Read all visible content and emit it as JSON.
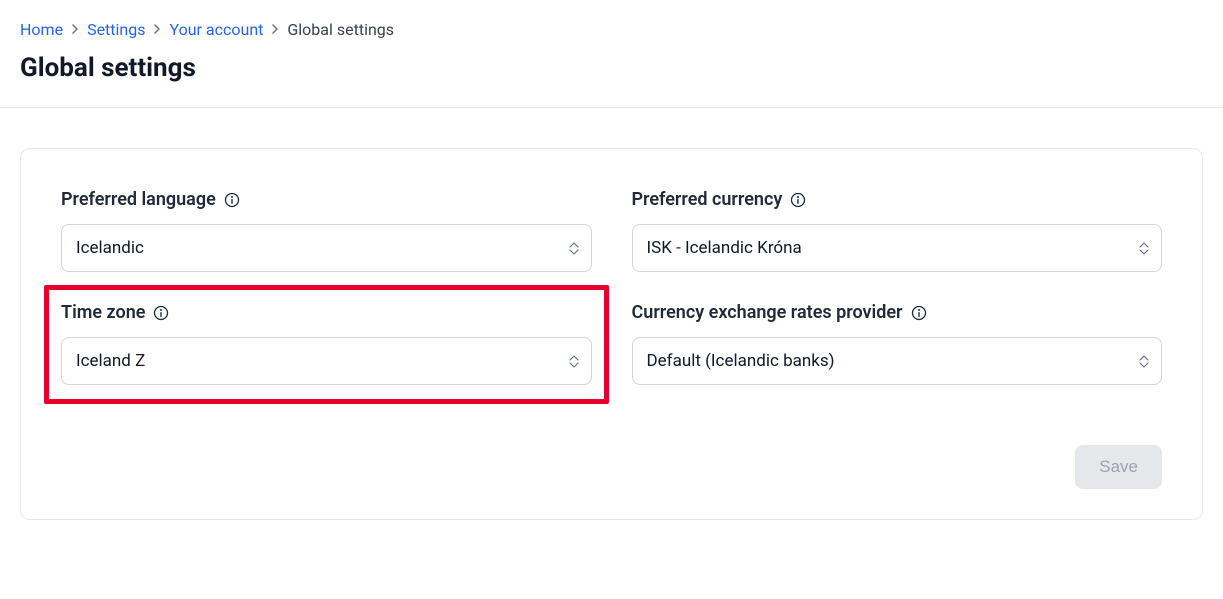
{
  "breadcrumb": {
    "home": "Home",
    "settings": "Settings",
    "your_account": "Your account",
    "current": "Global settings"
  },
  "page_title": "Global settings",
  "fields": {
    "language": {
      "label": "Preferred language",
      "value": "Icelandic"
    },
    "currency": {
      "label": "Preferred currency",
      "value": "ISK - Icelandic Króna"
    },
    "timezone": {
      "label": "Time zone",
      "value": "Iceland Z"
    },
    "exchange_provider": {
      "label": "Currency exchange rates provider",
      "value": "Default (Icelandic banks)"
    }
  },
  "actions": {
    "save": "Save"
  }
}
